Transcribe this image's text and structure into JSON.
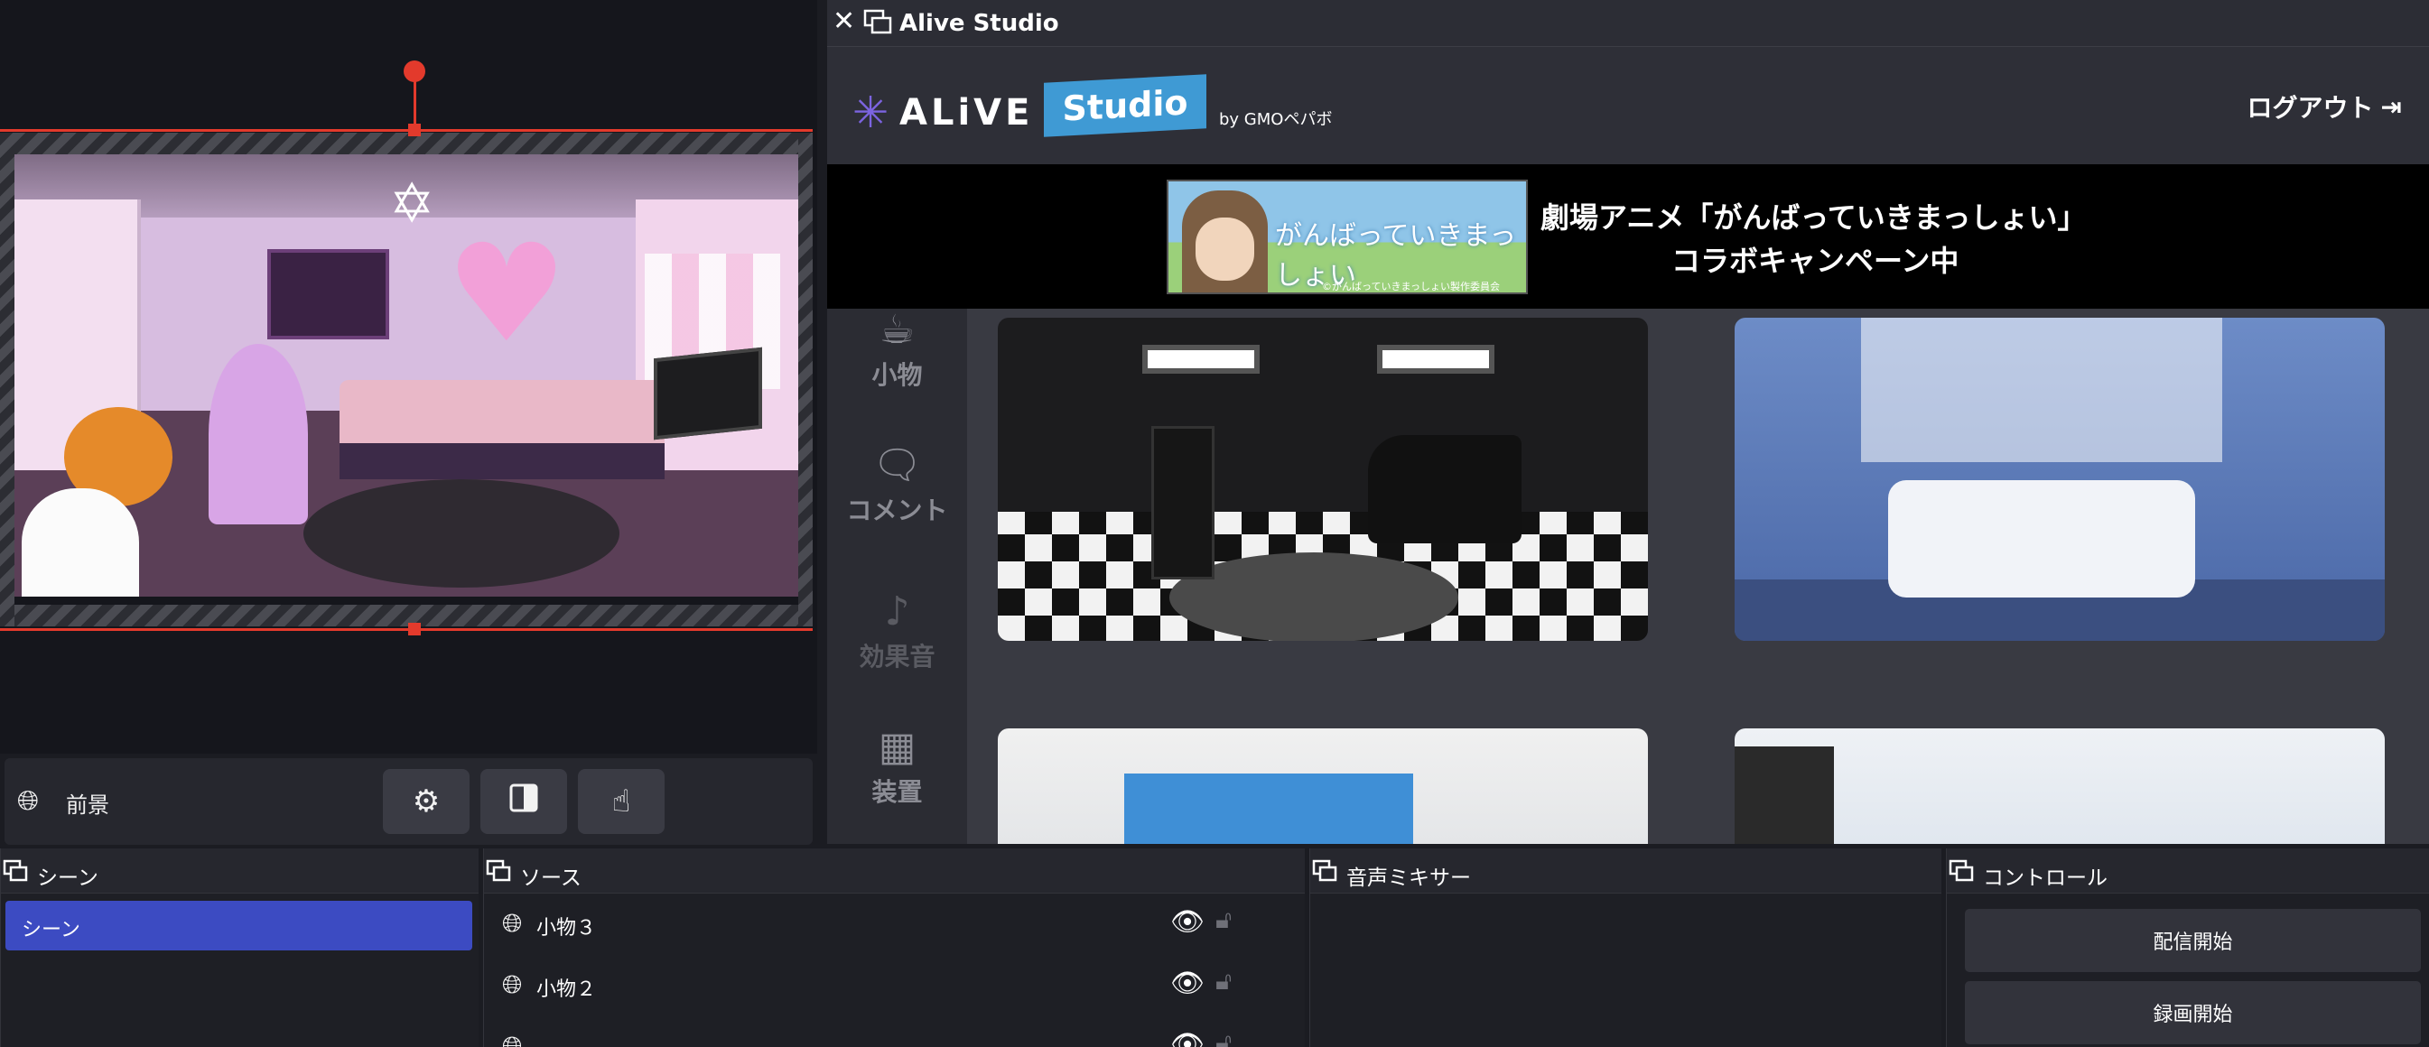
{
  "studio": {
    "title": "Alive Studio",
    "close_glyph": "✕",
    "logo": {
      "alive": "ALiVE",
      "studio": "Studio",
      "by": "by GMOペパボ"
    },
    "logout_label": "ログアウト",
    "banner": {
      "image_text": "がんばっていきまっしょい",
      "image_caption": "©がんばっていきまっしょい製作委員会",
      "line1": "劇場アニメ「がんばっていきまっしょい」",
      "line2": "コラボキャンペーン中"
    },
    "categories": [
      {
        "label": "小物",
        "icon": "cup-icon"
      },
      {
        "label": "コメント",
        "icon": "comment-icon"
      },
      {
        "label": "効果音",
        "icon": "music-note-icon"
      },
      {
        "label": "装置",
        "icon": "widgets-icon"
      }
    ]
  },
  "preview_bar": {
    "label": "前景"
  },
  "docks": {
    "scene": {
      "title": "シーン",
      "items": [
        "シーン"
      ]
    },
    "source": {
      "title": "ソース",
      "items": [
        {
          "name": "小物３"
        },
        {
          "name": "小物２"
        }
      ]
    },
    "mixer": {
      "title": "音声ミキサー"
    },
    "control": {
      "title": "コントロール",
      "stream_label": "配信開始",
      "record_label": "録画開始"
    }
  },
  "colors": {
    "accent": "#3c4bc2",
    "selection": "#e33a2c",
    "studio_blue": "#3f9ad4"
  }
}
